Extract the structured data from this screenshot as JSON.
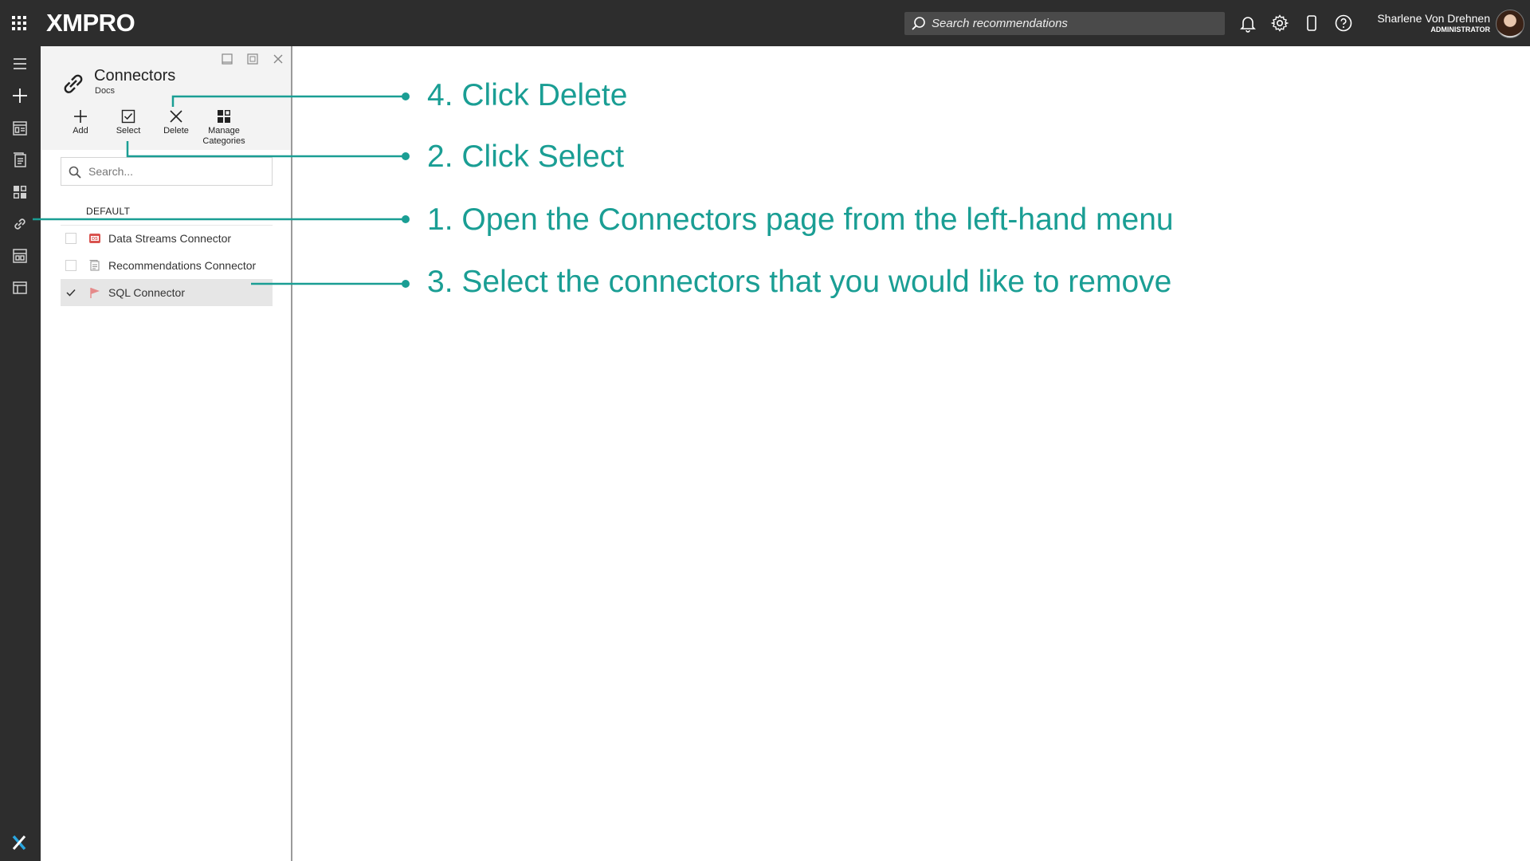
{
  "app": {
    "brand": "XMPRO",
    "colors": {
      "topbar": "#2d2d2d",
      "accent": "#1a9e94",
      "panel_header": "#f3f3f3"
    }
  },
  "topbar": {
    "search_placeholder": "Search recommendations",
    "icons": [
      "apps-grid-icon",
      "bell-icon",
      "gear-icon",
      "mobile-icon",
      "help-icon"
    ],
    "user": {
      "name": "Sharlene Von Drehnen",
      "role": "ADMINISTRATOR"
    }
  },
  "leftrail": {
    "icons": [
      "hamburger-menu-icon",
      "plus-icon",
      "table-icon",
      "clipboard-icon",
      "apps-icon",
      "link-icon",
      "calculator-icon",
      "window-icon",
      "xmpro-x-icon"
    ]
  },
  "panel": {
    "title": "Connectors",
    "subtitle": "Docs",
    "toolbar": {
      "add": "Add",
      "select": "Select",
      "delete": "Delete",
      "manage": "Manage Categories"
    },
    "search_placeholder": "Search...",
    "group": "DEFAULT",
    "items": [
      {
        "label": "Data Streams Connector",
        "checked": false,
        "icon": "data-streams-icon"
      },
      {
        "label": "Recommendations Connector",
        "checked": false,
        "icon": "recommendations-icon"
      },
      {
        "label": "SQL Connector",
        "checked": true,
        "icon": "sql-flag-icon"
      }
    ]
  },
  "annotations": [
    {
      "step": "4. Click Delete"
    },
    {
      "step": "2. Click Select"
    },
    {
      "step": "1. Open the Connectors page from the left-hand menu"
    },
    {
      "step": "3. Select the connectors that you would like to remove"
    }
  ]
}
